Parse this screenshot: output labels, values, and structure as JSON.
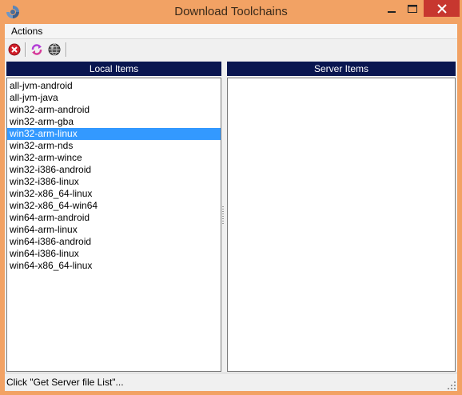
{
  "window": {
    "title": "Download Toolchains",
    "minimize_glyph": "—",
    "maximize_glyph": "☐",
    "close_glyph": "✕"
  },
  "menu": {
    "actions_label": "Actions"
  },
  "toolbar": {
    "icons": [
      "stop-icon",
      "refresh-icon",
      "globe-icon"
    ]
  },
  "local_panel": {
    "header": "Local Items",
    "items": [
      "all-jvm-android",
      "all-jvm-java",
      "win32-arm-android",
      "win32-arm-gba",
      "win32-arm-linux",
      "win32-arm-nds",
      "win32-arm-wince",
      "win32-i386-android",
      "win32-i386-linux",
      "win32-x86_64-linux",
      "win32-x86_64-win64",
      "win64-arm-android",
      "win64-arm-linux",
      "win64-i386-android",
      "win64-i386-linux",
      "win64-x86_64-linux"
    ],
    "selected_item": "win32-arm-linux"
  },
  "server_panel": {
    "header": "Server Items",
    "items": []
  },
  "status": {
    "text": "Click \"Get Server file List\"..."
  },
  "colors": {
    "frame": "#f2a264",
    "header_bg": "#0a1650",
    "selection": "#3399ff",
    "close_button": "#c7372f"
  }
}
